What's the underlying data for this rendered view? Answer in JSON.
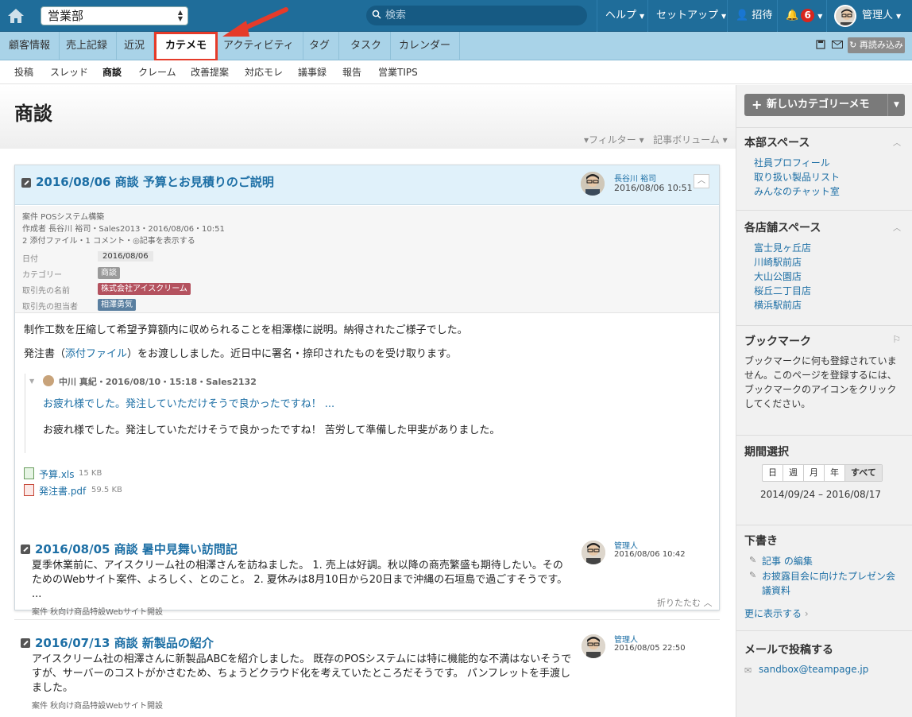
{
  "topbar": {
    "space": "営業部",
    "search_placeholder": "検索",
    "help": "ヘルプ",
    "setup": "セットアップ",
    "invite": "招待",
    "notification_count": "6",
    "user": "管理人"
  },
  "tabs": [
    "顧客情報",
    "売上記録",
    "近況",
    "カテメモ",
    "アクティビティ",
    "タグ",
    "タスク",
    "カレンダー"
  ],
  "reload_label": "再読み込み",
  "subnav": [
    "投稿",
    "スレッド",
    "商談",
    "クレーム",
    "改善提案",
    "対応モレ",
    "議事録",
    "報告",
    "営業TIPS"
  ],
  "page": {
    "title": "商談",
    "filter": "フィルター",
    "volume": "記事ボリューム"
  },
  "post": {
    "title": "2016/08/06 商談 予算とお見積りのご説明",
    "author": "長谷川 裕司",
    "date": "2016/08/06 10:51",
    "case_line": "案件 POSシステム構築",
    "author_line": "作成者 長谷川 裕司・Sales2013・2016/08/06・10:51",
    "attach_line": "2 添付ファイル・1 コメント・◎記事を表示する",
    "field_date_label": "日付",
    "field_date": "2016/08/06",
    "field_cat_label": "カテゴリー",
    "field_cat": "商談",
    "field_client_label": "取引先の名前",
    "field_client": "株式会社アイスクリーム",
    "field_contact_label": "取引先の担当者",
    "field_contact": "相澤勇気",
    "body1": "制作工数を圧縮して希望予算額内に収められることを相澤様に説明。納得されたご様子でした。",
    "body2_pre": "発注書（",
    "body2_link": "添付ファイル",
    "body2_post": "）をお渡ししました。近日中に署名・捺印されたものを受け取ります。",
    "comment_meta": "中川 真紀・2016/08/10・15:18・Sales2132",
    "comment_preview": "お疲れ様でした。発注していただけそうで良かったですね！ ...",
    "comment_body": "お疲れ様でした。発注していただけそうで良かったですね！ 苦労して準備した甲斐がありました。",
    "files": [
      {
        "name": "予算.xls",
        "size": "15 KB"
      },
      {
        "name": "発注書.pdf",
        "size": "59.5 KB"
      }
    ],
    "collapse": "折りたたむ"
  },
  "items": [
    {
      "title": "2016/08/05 商談 暑中見舞い訪問記",
      "author": "管理人",
      "date": "2016/08/06 10:42",
      "line1": "夏季休業前に、アイスクリーム社の相澤さんを訪ねました。 1. 売上は好調。秋以降の商売繁盛も期待したい。その",
      "line2": "ためのWebサイト案件、よろしく、とのこと。 2. 夏休みは8月10日から20日まで沖縄の石垣島で過ごすそうです。",
      "line3": "...",
      "case": "案件 秋向け商品特設Webサイト開設"
    },
    {
      "title": "2016/07/13 商談 新製品の紹介",
      "author": "管理人",
      "date": "2016/08/05 22:50",
      "line1": "アイスクリーム社の相澤さんに新製品ABCを紹介しました。 既存のPOSシステムには特に機能的な不満はないそうで",
      "line2": "すが、サーバーのコストがかさむため、ちょうどクラウド化を考えていたところだそうです。 パンフレットを手渡し",
      "line3": "ました。",
      "case": "案件 秋向け商品特設Webサイト開設"
    }
  ],
  "sidebar": {
    "new_button": "新しいカテゴリーメモ",
    "hq_title": "本部スペース",
    "hq_links": [
      "社員プロフィール",
      "取り扱い製品リスト",
      "みんなのチャット室"
    ],
    "stores_title": "各店舗スペース",
    "stores_links": [
      "富士見ヶ丘店",
      "川崎駅前店",
      "大山公園店",
      "桜丘二丁目店",
      "横浜駅前店"
    ],
    "bookmark_title": "ブックマーク",
    "bookmark_text": [
      "ブックマークに何も登録されていま",
      "せん。このページを登録するには、",
      "ブックマークのアイコンをクリック",
      "してください。"
    ],
    "period_title": "期間選択",
    "period_buttons": [
      "日",
      "週",
      "月",
      "年",
      "すべて"
    ],
    "period_range": "2014/09/24 – 2016/08/17",
    "drafts_title": "下書き",
    "drafts": [
      "記事 の編集",
      "お披露目会に向けたプレゼン会",
      "議資料"
    ],
    "more": "更に表示する",
    "mail_title": "メールで投稿する",
    "mail": "sandbox@teampage.jp"
  },
  "colors": {
    "topbar": "#1f6d9a",
    "tabbar": "#a9d3e8",
    "highlight": "#e53b2a",
    "link": "#1d6fa5"
  }
}
